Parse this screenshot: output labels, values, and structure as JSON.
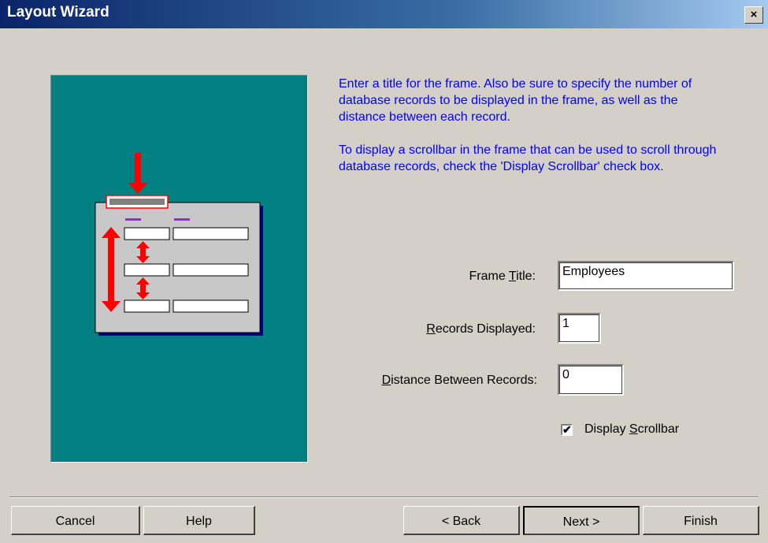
{
  "window": {
    "title": "Layout Wizard",
    "close_label": "×"
  },
  "instructions": {
    "paragraph1": "Enter a title for the frame. Also be sure to specify the number of database records to be displayed in the frame, as well as the distance between each record.",
    "paragraph2": "To display a scrollbar in the frame that can be used to scroll through database records, check the 'Display Scrollbar' check box."
  },
  "fields": {
    "frame_title": {
      "label_pre": "Frame ",
      "label_u": "T",
      "label_post": "itle:",
      "value": "Employees"
    },
    "records_displayed": {
      "label_pre": "",
      "label_u": "R",
      "label_post": "ecords Displayed:",
      "value": "1"
    },
    "distance": {
      "label_pre": "",
      "label_u": "D",
      "label_post": "istance Between Records:",
      "value": "0"
    }
  },
  "checkbox": {
    "label_pre": "Display ",
    "label_u": "S",
    "label_post": "crollbar",
    "checked": true,
    "mark": "✔"
  },
  "buttons": {
    "cancel": "Cancel",
    "help": "Help",
    "back": "< Back",
    "next": "Next >",
    "finish": "Finish"
  },
  "colors": {
    "instruction_text": "#0000ff",
    "preview_bg": "#008080",
    "arrow": "#ff0000"
  }
}
